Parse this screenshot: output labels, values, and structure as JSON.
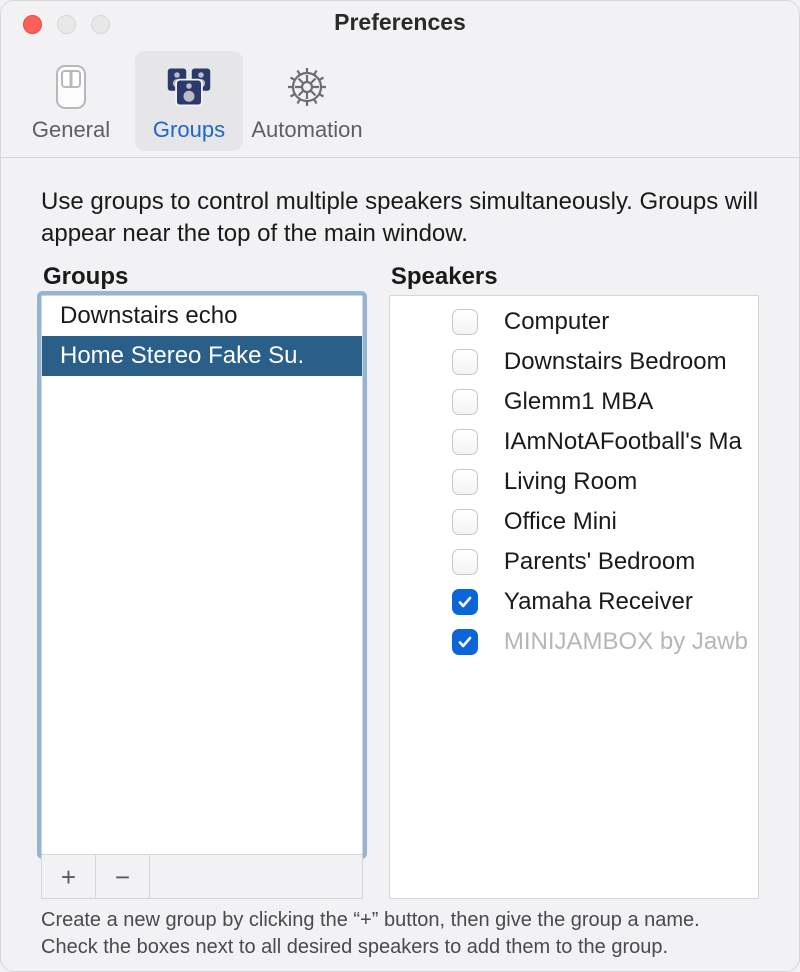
{
  "window": {
    "title": "Preferences"
  },
  "tabs": [
    {
      "label": "General",
      "icon": "switch-icon",
      "selected": false
    },
    {
      "label": "Groups",
      "icon": "speakers-icon",
      "selected": true
    },
    {
      "label": "Automation",
      "icon": "gear-icon",
      "selected": false
    }
  ],
  "intro_text": "Use groups to control multiple speakers simultaneously. Groups will appear near the top of the main window.",
  "columns": {
    "groups_header": "Groups",
    "speakers_header": "Speakers"
  },
  "groups": [
    {
      "name": "Downstairs echo",
      "selected": false
    },
    {
      "name": "Home Stereo Fake Su.",
      "selected": true
    }
  ],
  "group_buttons": {
    "add_label": "+",
    "remove_label": "−"
  },
  "speakers": [
    {
      "name": "Computer",
      "checked": false,
      "disabled": false
    },
    {
      "name": "Downstairs Bedroom",
      "checked": false,
      "disabled": false
    },
    {
      "name": "Glemm1 MBA",
      "checked": false,
      "disabled": false
    },
    {
      "name": "IAmNotAFootball's Ma",
      "checked": false,
      "disabled": false
    },
    {
      "name": "Living Room",
      "checked": false,
      "disabled": false
    },
    {
      "name": "Office Mini",
      "checked": false,
      "disabled": false
    },
    {
      "name": "Parents' Bedroom",
      "checked": false,
      "disabled": false
    },
    {
      "name": "Yamaha Receiver",
      "checked": true,
      "disabled": false
    },
    {
      "name": "MINIJAMBOX by Jawb",
      "checked": true,
      "disabled": true
    }
  ],
  "footer_text": "Create a new group by clicking the “+” button, then give the group a name. Check the boxes next to all desired speakers to add them to the group."
}
